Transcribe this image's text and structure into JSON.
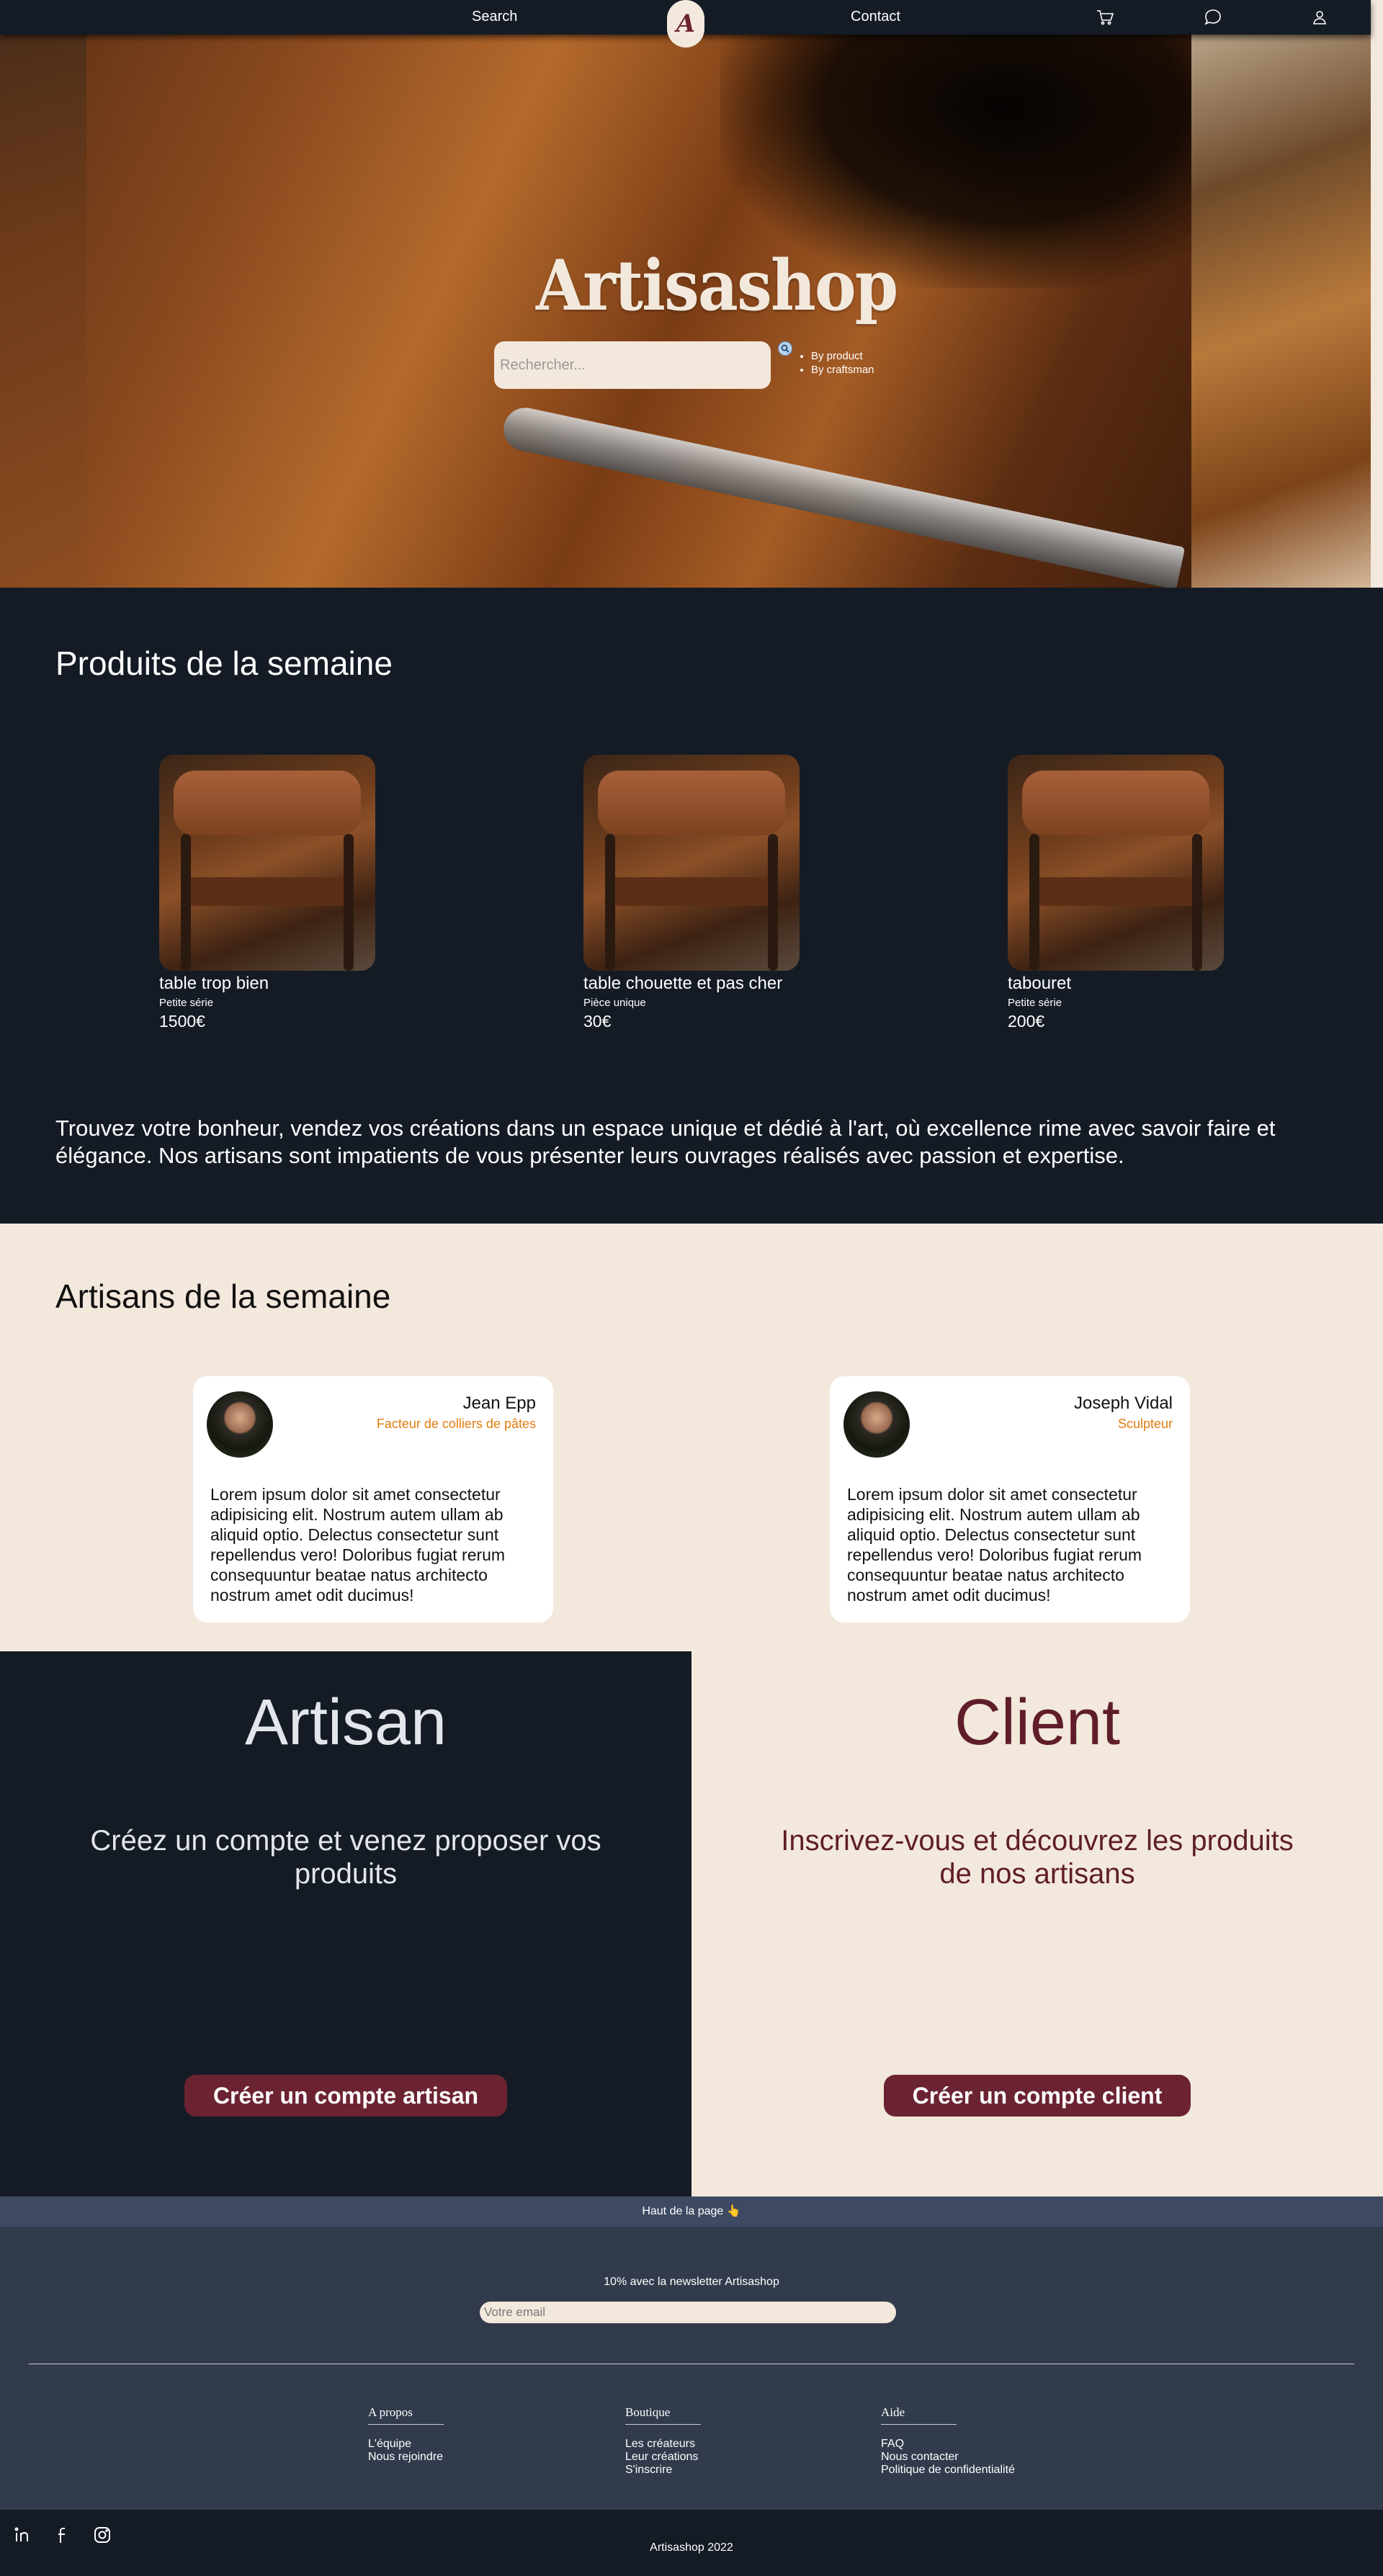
{
  "nav": {
    "search": "Search",
    "contact": "Contact",
    "logo_letter": "A",
    "icons": [
      "cart-icon",
      "chat-icon",
      "user-icon"
    ]
  },
  "hero": {
    "title": "Artisashop",
    "search_placeholder": "Rechercher...",
    "filters": [
      "By product",
      "By craftsman"
    ]
  },
  "products": {
    "title": "Produits de la semaine",
    "items": [
      {
        "name": "table trop bien",
        "type": "Petite série",
        "price": "1500€"
      },
      {
        "name": "table chouette et pas cher",
        "type": "Pièce unique",
        "price": "30€"
      },
      {
        "name": "tabouret",
        "type": "Petite série",
        "price": "200€"
      }
    ],
    "tagline": "Trouvez votre bonheur, vendez vos créations dans un espace unique et dédié à l'art, où excellence rime avec savoir faire et élégance. Nos artisans sont impatients de vous présenter leurs ouvrages réalisés avec passion et expertise."
  },
  "artisans": {
    "title": "Artisans de la semaine",
    "items": [
      {
        "name": "Jean Epp",
        "role": "Facteur de colliers de pâtes",
        "bio": "Lorem ipsum dolor sit amet consectetur adipisicing elit. Nostrum autem ullam ab aliquid optio. Delectus consectetur sunt repellendus vero! Doloribus fugiat rerum consequuntur beatae natus architecto nostrum amet odit ducimus!"
      },
      {
        "name": "Joseph Vidal",
        "role": "Sculpteur",
        "bio": "Lorem ipsum dolor sit amet consectetur adipisicing elit. Nostrum autem ullam ab aliquid optio. Delectus consectetur sunt repellendus vero! Doloribus fugiat rerum consequuntur beatae natus architecto nostrum amet odit ducimus!"
      }
    ]
  },
  "signup": {
    "artisan": {
      "title": "Artisan",
      "text": "Créez un compte et venez proposer vos produits",
      "button": "Créer un compte artisan"
    },
    "client": {
      "title": "Client",
      "text": "Inscrivez-vous et découvrez les produits de nos artisans",
      "button": "Créer un compte client"
    }
  },
  "back_to_top": "Haut de la page 👆",
  "footer": {
    "newsletter_label": "10% avec la newsletter Artisashop",
    "newsletter_placeholder": "Votre email",
    "columns": [
      {
        "title": "A propos",
        "links": [
          "L'équipe",
          "Nous rejoindre"
        ]
      },
      {
        "title": "Boutique",
        "links": [
          "Les créateurs",
          "Leur créations",
          "S'inscrire"
        ]
      },
      {
        "title": "Aide",
        "links": [
          "FAQ",
          "Nous contacter",
          "Politique de confidentialité"
        ]
      }
    ],
    "social": [
      "linkedin-icon",
      "facebook-icon",
      "instagram-icon"
    ],
    "copyright": "Artisashop 2022"
  },
  "colors": {
    "dark": "#141b25",
    "cream": "#f3e8dc",
    "burgundy": "#6b2331",
    "accent_orange": "#e37c10",
    "footer": "#323b4c",
    "back_to_top": "#3e4a61"
  }
}
